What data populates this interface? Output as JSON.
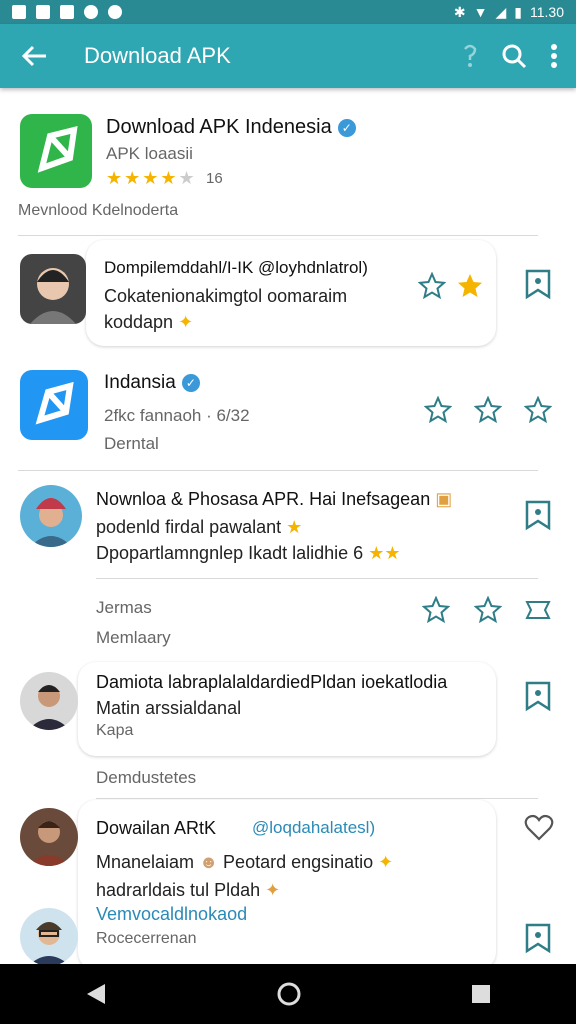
{
  "status": {
    "time": "11.30"
  },
  "appbar": {
    "title": "Download APK"
  },
  "header": {
    "title": "Download APK Indenesia",
    "subtitle": "APK loaasii",
    "rating_count": "16",
    "footer": "Mevnlood Kdelnoderta"
  },
  "items": [
    {
      "name": "Dompilemddahl/I-IK @loyhdnlatrol)",
      "line1": "Cokatenionakimgtol oomaraim",
      "line2": "koddapn"
    },
    {
      "name": "Indansia",
      "line1": "2fkc fannaoh · 6/32",
      "line2": "Derntal"
    },
    {
      "name": "Nownloa & Phosasa APR. Hai Inefsagean",
      "line1": "podenld firdal pawalant",
      "line2": "Dpopartlamngnlep Ikadt lalidhie 6"
    },
    {
      "line1": "Jermas",
      "line2": "Memlaary"
    },
    {
      "name": "Damiota labraplalaldardiedPldan ioekatlodia",
      "line1": "Matin arssialdanal",
      "line2": "Kapa"
    },
    {
      "line1": "Demdustetes"
    },
    {
      "name": "Dowailan ARtK",
      "handle": "@loqdahalatesl)",
      "line1": "Mnanelaiam",
      "line1b": "Peotard engsinatio",
      "line2": "hadrarldais tul Pldah"
    },
    {
      "name": "Vemvocaldlnokaod",
      "line1": "Rocecerrenan"
    }
  ],
  "colors": {
    "appbar": "#2ea7b3",
    "statusbar": "#2a8a93",
    "star": "#f4b400",
    "accent": "#2f7d86"
  }
}
